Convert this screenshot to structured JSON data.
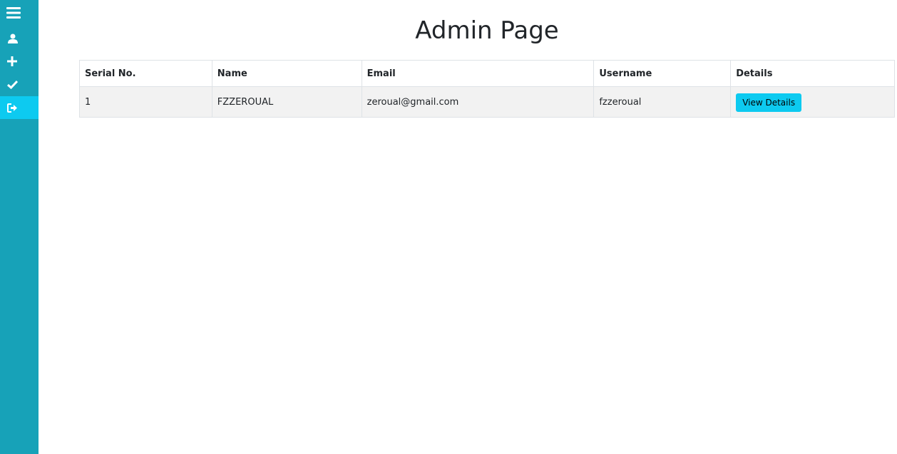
{
  "sidebar": {
    "items": [
      {
        "icon": "menu-icon"
      },
      {
        "icon": "user-icon"
      },
      {
        "icon": "plus-icon"
      },
      {
        "icon": "check-icon"
      },
      {
        "icon": "sign-out-icon",
        "active": true
      }
    ],
    "colors": {
      "background": "#17a2b8",
      "active": "#0dcaf0"
    }
  },
  "page": {
    "title": "Admin Page"
  },
  "table": {
    "headers": [
      "Serial No.",
      "Name",
      "Email",
      "Username",
      "Details"
    ],
    "rows": [
      {
        "serial": "1",
        "name": "FZZEROUAL",
        "email": "zeroual@gmail.com",
        "username": "fzzeroual",
        "details_button": "View Details"
      }
    ]
  }
}
